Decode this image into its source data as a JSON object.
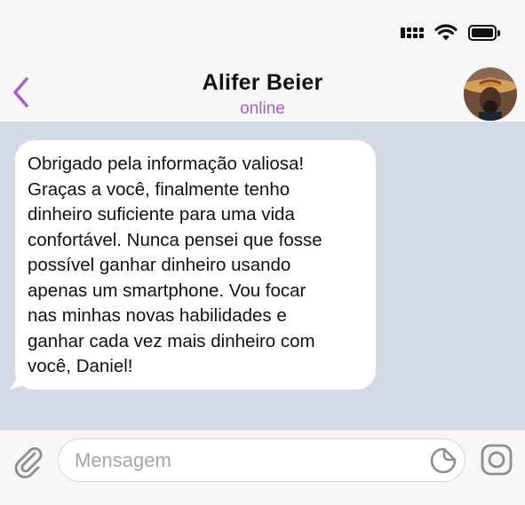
{
  "status_bar": {
    "icons": [
      "signal-icon",
      "wifi-icon",
      "battery-icon"
    ]
  },
  "header": {
    "back_icon": "chevron-left-icon",
    "contact_name": "Alifer Beier",
    "contact_status": "online",
    "avatar_icon": "avatar"
  },
  "messages": [
    {
      "direction": "incoming",
      "lines": [
        "Obrigado pela informação valiosa!",
        "Graças a você, finalmente tenho",
        "dinheiro suficiente para uma vida",
        "confortável. Nunca pensei que fosse",
        "possível ganhar dinheiro usando",
        "apenas um smartphone. Vou focar",
        "nas minhas novas habilidades e",
        "ganhar cada vez mais dinheiro com",
        "você, Daniel!"
      ]
    }
  ],
  "composer": {
    "placeholder": "Mensagem",
    "value": "",
    "attach_icon": "paperclip-icon",
    "sticker_icon": "sticker-icon",
    "camera_icon": "camera-icon"
  },
  "colors": {
    "accent": "#a463c8",
    "chat_background": "#d3d9e5",
    "bubble": "#ffffff"
  }
}
